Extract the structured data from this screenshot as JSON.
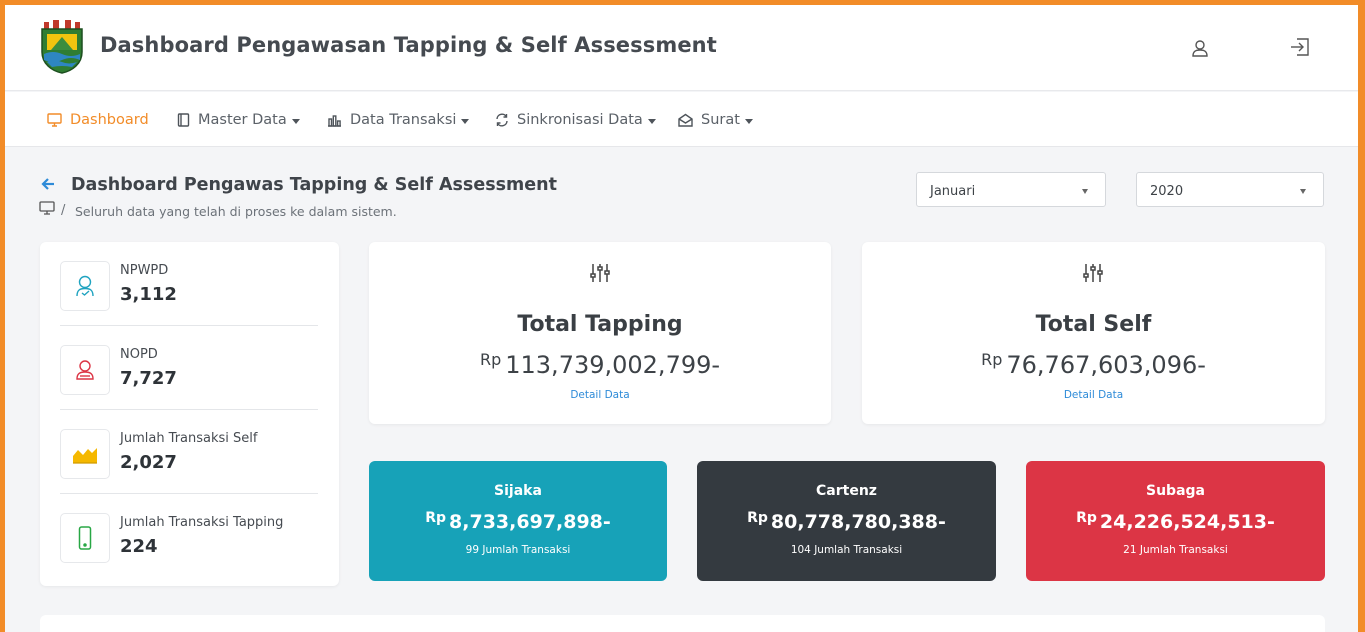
{
  "header": {
    "title": "Dashboard Pengawasan Tapping & Self Assessment",
    "icons": [
      "logo-emblem",
      "user-icon",
      "logout-icon"
    ]
  },
  "nav": {
    "items": [
      {
        "label": "Dashboard",
        "icon": "monitor-icon",
        "active": true,
        "dropdown": false
      },
      {
        "label": "Master Data",
        "icon": "book-icon",
        "active": false,
        "dropdown": true
      },
      {
        "label": "Data Transaksi",
        "icon": "bar-chart-icon",
        "active": false,
        "dropdown": true
      },
      {
        "label": "Sinkronisasi Data",
        "icon": "sync-icon",
        "active": false,
        "dropdown": true
      },
      {
        "label": "Surat",
        "icon": "envelope-icon",
        "active": false,
        "dropdown": true
      }
    ]
  },
  "page": {
    "title": "Dashboard Pengawas Tapping & Self Assessment",
    "breadcrumb_sep": "/",
    "breadcrumb": "Seluruh data yang telah di proses ke dalam sistem."
  },
  "filters": {
    "month": "Januari",
    "year": "2020"
  },
  "stats": [
    {
      "label": "NPWPD",
      "value": "3,112",
      "icon": "user-outline-icon",
      "color": "#1fa3c0"
    },
    {
      "label": "NOPD",
      "value": "7,727",
      "icon": "users-outline-icon",
      "color": "#dc3545"
    },
    {
      "label": "Jumlah Transaksi Self",
      "value": "2,027",
      "icon": "area-chart-icon",
      "color": "#f5b800"
    },
    {
      "label": "Jumlah Transaksi Tapping",
      "value": "224",
      "icon": "mobile-icon",
      "color": "#28a745"
    }
  ],
  "totals": [
    {
      "title": "Total Tapping",
      "currency": "Rp",
      "amount": "113,739,002,799-",
      "link": "Detail Data",
      "icon": "sliders-icon"
    },
    {
      "title": "Total Self",
      "currency": "Rp",
      "amount": "76,767,603,096-",
      "link": "Detail Data",
      "icon": "sliders-icon"
    }
  ],
  "sources": [
    {
      "name": "Sijaka",
      "currency": "Rp",
      "amount": "8,733,697,898-",
      "count": "99 Jumlah Transaksi",
      "color": "#17a2b8"
    },
    {
      "name": "Cartenz",
      "currency": "Rp",
      "amount": "80,778,780,388-",
      "count": "104 Jumlah Transaksi",
      "color": "#343a40"
    },
    {
      "name": "Subaga",
      "currency": "Rp",
      "amount": "24,226,524,513-",
      "count": "21 Jumlah Transaksi",
      "color": "#dc3545"
    }
  ],
  "colors": {
    "accent": "#f28c28",
    "link": "#2e8bd8"
  }
}
